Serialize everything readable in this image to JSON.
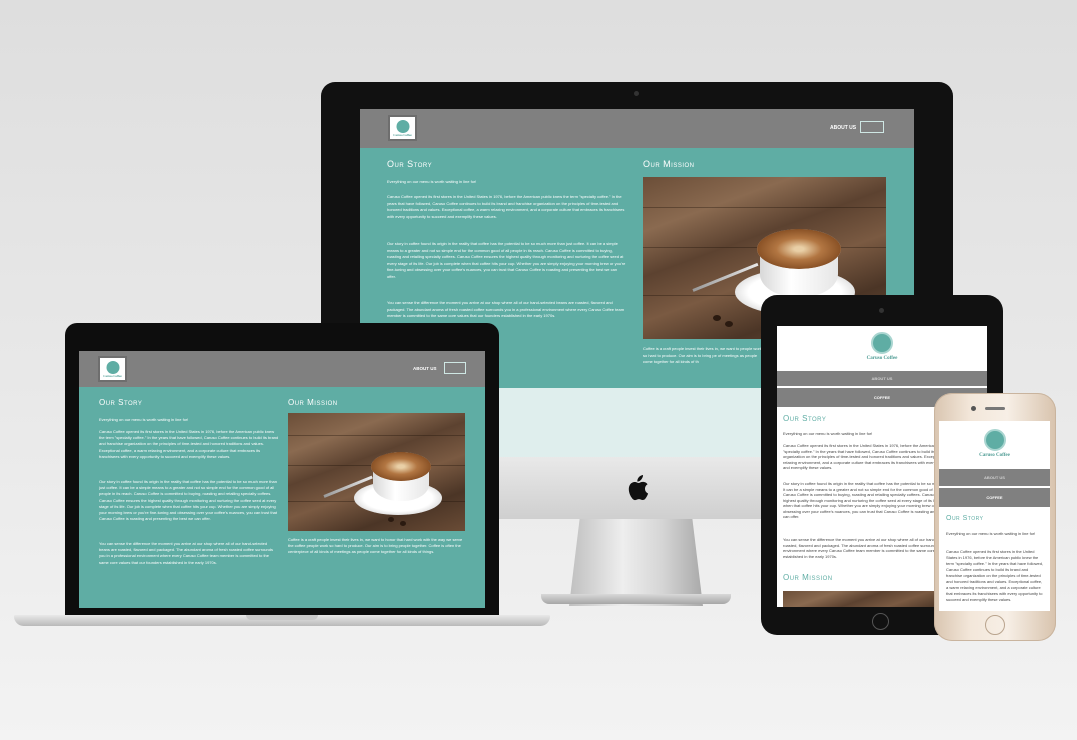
{
  "site": {
    "logo_text": "Caruso Coffee",
    "nav_about": "ABOUT US",
    "nav_coffee": "COFFEE",
    "story_title": "Our Story",
    "story_tagline": "Everything on our menu is worth waiting in line for!",
    "story_p1": "Caruso Coffee opened its first stores in the United States in 1976, before the American public knew the term \"specialty coffee.\" In the years that have followed, Caruso Coffee continues to build its brand and franchise organization on the principles of time-tested and honored traditions and values. Exceptional coffee, a warm relaxing environment, and a corporate culture that embraces its franchisees with every opportunity to succeed and exemplify these values.",
    "story_p2": "Our story in coffee found its origin in the reality that coffee has the potential to be so much more than just coffee. It can be a simple means to a greater and not so simple end for the common good of all people in its reach. Caruso Coffee is committed to buying, roasting and retailing specialty coffees. Caruso Coffee ensures the highest quality through monitoring and nurturing the coffee seed at every stage of its life. Our job is complete when that coffee hits your cup. Whether you are simply enjoying your morning brew or you're fine-tuning and obsessing over your coffee's nuances, you can trust that Caruso Coffee is roasting and presenting the best we can offer.",
    "story_p3": "You can sense the difference the moment you arrive at our shop where all of our hand-selected beans are roasted, flavored and packaged. The abundant aroma of fresh roasted coffee surrounds you in a professional environment where every Caruso Coffee team member is committed to the same core values that our founders established in the early 1970s.",
    "mission_title": "Our Mission",
    "mission_text": "Coffee is a craft people invest their lives in, we want to honor that hard work with the way we serve the coffee people work so hard to produce. Our aim is to bring people together. Coffee is often the centerpiece of all kinds of meetings as people come together for all kinds of things.",
    "mission_text_short": "Coffee is a craft people invest their lives in, we want to people work so hard to produce. Our aim is to bring pe of meetings as people come together for all kinds of th"
  },
  "colors": {
    "teal": "#5fada4",
    "nav_gray": "#808080",
    "logo_teal": "#4d9b93",
    "device_black": "#111111",
    "phone_gold": "#e8d6c2"
  },
  "devices": [
    "desktop-monitor",
    "laptop",
    "tablet",
    "phone"
  ],
  "icons": [
    "apple-logo-icon",
    "coffee-cup-logo-icon",
    "home-button-icon",
    "camera-icon"
  ]
}
